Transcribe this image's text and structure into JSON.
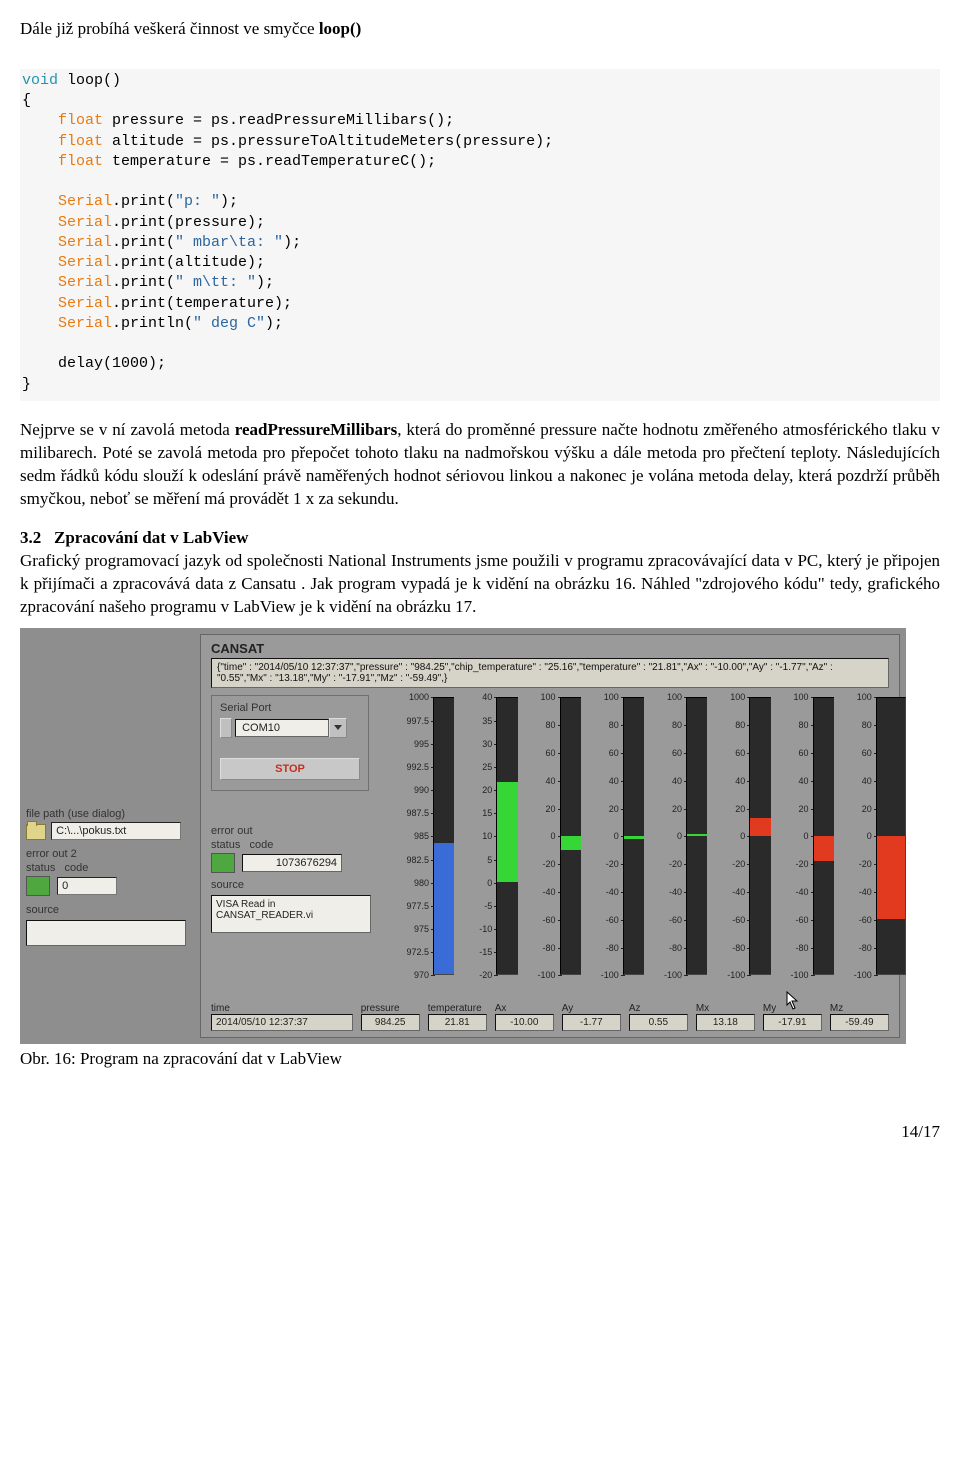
{
  "intro": "Dále již probíhá veškerá činnost ve smyčce ",
  "intro_bold": "loop()",
  "code": {
    "l1a": "void",
    "l1b": " loop()",
    "l2": "{",
    "l3a": "    float",
    "l3b": " pressure = ps.readPressureMillibars();",
    "l4a": "    float",
    "l4b": " altitude = ps.pressureToAltitudeMeters(pressure);",
    "l5a": "    float",
    "l5b": " temperature = ps.readTemperatureC();",
    "blank1": "",
    "l6a": "    Serial",
    "l6b": ".print(",
    "l6c": "\"p: \"",
    "l6d": ");",
    "l7a": "    Serial",
    "l7b": ".print(pressure);",
    "l8a": "    Serial",
    "l8b": ".print(",
    "l8c": "\" mbar\\ta: \"",
    "l8d": ");",
    "l9a": "    Serial",
    "l9b": ".print(altitude);",
    "l10a": "    Serial",
    "l10b": ".print(",
    "l10c": "\" m\\tt: \"",
    "l10d": ");",
    "l11a": "    Serial",
    "l11b": ".print(temperature);",
    "l12a": "    Serial",
    "l12b": ".println(",
    "l12c": "\" deg C\"",
    "l12d": ");",
    "blank2": "",
    "l13": "    delay(1000);",
    "l14": "}"
  },
  "para1a": "Nejprve se v ní zavolá metoda ",
  "para1b": "readPressureMillibars",
  "para1c": ", která do proměnné pressure načte hodnotu změřeného atmosférického tlaku v milibarech. Poté se zavolá metoda pro přepočet tohoto tlaku na nadmořskou výšku a dále metoda pro přečtení teploty. Následujících sedm řádků kódu slouží k odeslání právě naměřených hodnot sériovou linkou a nakonec je volána metoda delay, která pozdrží průběh smyčkou, neboť se měření má provádět  1 x za sekundu.",
  "sec_num": "3.2",
  "sec_title": "Zpracování dat v LabView",
  "para2": "Grafický programovací jazyk od společnosti National Instruments jsme použili v programu zpracovávající  data v PC, který je připojen k přijímači a zpracovává data z Cansatu . Jak program vypadá je k vidění na obrázku 16. Náhled \"zdrojového kódu\" tedy, grafického zpracování našeho programu v LabView je k vidění na obrázku 17.",
  "caption": "Obr. 16: Program na zpracování dat v LabView",
  "page": "14/17",
  "lv": {
    "title": "CANSAT",
    "log": "{\"time\" : \"2014/05/10 12:37:37\",\"pressure\" : \"984.25\",\"chip_temperature\" : \"25.16\",\"temperature\" : \"21.81\",\"Ax\" : \"-10.00\",\"Ay\" : \"-1.77\",\"Az\" : \"0.55\",\"Mx\" : \"13.18\",\"My\" : \"-17.91\",\"Mz\" : \"-59.49\",}",
    "serial_label": "Serial Port",
    "serial_value": "COM10",
    "stop": "STOP",
    "error_label": "error out",
    "status_label": "status",
    "code_label": "code",
    "code_value": "1073676294",
    "source_label": "source",
    "source_value": "VISA Read in CANSAT_READER.vi",
    "left_file_label": "file path (use dialog)",
    "left_file_value": "C:\\...\\pokus.txt",
    "left_error_label": "error out 2",
    "left_code_value": "0",
    "time_label": "time",
    "time_value": "2014/05/10 12:37:37",
    "fields": [
      {
        "label": "pressure",
        "value": "984.25"
      },
      {
        "label": "temperature",
        "value": "21.81"
      },
      {
        "label": "Ax",
        "value": "-10.00"
      },
      {
        "label": "Ay",
        "value": "-1.77"
      },
      {
        "label": "Az",
        "value": "0.55"
      },
      {
        "label": "Mx",
        "value": "13.18"
      },
      {
        "label": "My",
        "value": "-17.91"
      },
      {
        "label": "Mz",
        "value": "-59.49"
      }
    ]
  },
  "chart_data": [
    {
      "type": "bar",
      "label": "pressure",
      "ticks": [
        "1000",
        "997.5",
        "995",
        "992.5",
        "990",
        "987.5",
        "985",
        "982.5",
        "980",
        "977.5",
        "975",
        "972.5",
        "970"
      ],
      "ylim": [
        970,
        1000
      ],
      "value": 984.25,
      "color": "blue"
    },
    {
      "type": "bar",
      "label": "temperature",
      "ticks": [
        "40",
        "35",
        "30",
        "25",
        "20",
        "15",
        "10",
        "5",
        "0",
        "-5",
        "-10",
        "-15",
        "-20"
      ],
      "ylim": [
        -20,
        40
      ],
      "value": 21.81,
      "color": "green"
    },
    {
      "type": "bar",
      "label": "Ax",
      "ticks": [
        "100",
        "80",
        "60",
        "40",
        "20",
        "0",
        "-20",
        "-40",
        "-60",
        "-80",
        "-100"
      ],
      "ylim": [
        -100,
        100
      ],
      "value": -10.0,
      "color": "green"
    },
    {
      "type": "bar",
      "label": "Ay",
      "ticks": [
        "100",
        "80",
        "60",
        "40",
        "20",
        "0",
        "-20",
        "-40",
        "-60",
        "-80",
        "-100"
      ],
      "ylim": [
        -100,
        100
      ],
      "value": -1.77,
      "color": "green"
    },
    {
      "type": "bar",
      "label": "Az",
      "ticks": [
        "100",
        "80",
        "60",
        "40",
        "20",
        "0",
        "-20",
        "-40",
        "-60",
        "-80",
        "-100"
      ],
      "ylim": [
        -100,
        100
      ],
      "value": 0.55,
      "color": "green"
    },
    {
      "type": "bar",
      "label": "Mx",
      "ticks": [
        "100",
        "80",
        "60",
        "40",
        "20",
        "0",
        "-20",
        "-40",
        "-60",
        "-80",
        "-100"
      ],
      "ylim": [
        -100,
        100
      ],
      "value": 13.18,
      "color": "red"
    },
    {
      "type": "bar",
      "label": "My",
      "ticks": [
        "100",
        "80",
        "60",
        "40",
        "20",
        "0",
        "-20",
        "-40",
        "-60",
        "-80",
        "-100"
      ],
      "ylim": [
        -100,
        100
      ],
      "value": -17.91,
      "color": "red"
    },
    {
      "type": "bar",
      "label": "Mz",
      "ticks": [
        "100",
        "80",
        "60",
        "40",
        "20",
        "0",
        "-20",
        "-40",
        "-60",
        "-80",
        "-100"
      ],
      "ylim": [
        -100,
        100
      ],
      "value": -59.49,
      "color": "red"
    }
  ]
}
